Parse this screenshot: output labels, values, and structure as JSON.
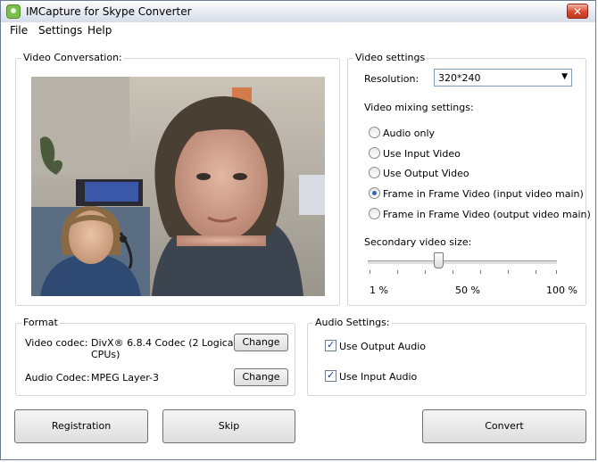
{
  "window": {
    "title": "IMCapture for Skype Converter",
    "close_glyph": "✕"
  },
  "menu": [
    "File",
    "Settings",
    "Help"
  ],
  "video_conversation": {
    "legend": "Video Conversation:"
  },
  "video_settings": {
    "legend": "Video settings",
    "resolution_label": "Resolution:",
    "resolution_value": "320*240",
    "mixing_label": "Video mixing settings:",
    "mixing_options": [
      {
        "label": "Audio only",
        "selected": false
      },
      {
        "label": "Use Input Video",
        "selected": false
      },
      {
        "label": "Use Output Video",
        "selected": false
      },
      {
        "label": "Frame in Frame Video (input video main)",
        "selected": true
      },
      {
        "label": "Frame in Frame Video (output video main)",
        "selected": false
      }
    ],
    "secondary_size_label": "Secondary video size:",
    "slider_value_percent": 35,
    "slider_labels": [
      "1 %",
      "50 %",
      "100 %"
    ]
  },
  "format": {
    "legend": "Format",
    "video_codec_label": "Video codec:",
    "video_codec_value_line1": "DivX® 6.8.4 Codec (2 Logical",
    "video_codec_value_line2": "CPUs)",
    "audio_codec_label": "Audio Codec:",
    "audio_codec_value": "MPEG Layer-3",
    "change_label": "Change"
  },
  "audio_settings": {
    "legend": "Audio Settings:",
    "options": [
      {
        "label": "Use Output Audio",
        "checked": true
      },
      {
        "label": "Use Input Audio",
        "checked": true
      }
    ]
  },
  "buttons": {
    "registration": "Registration",
    "skip": "Skip",
    "convert": "Convert"
  }
}
